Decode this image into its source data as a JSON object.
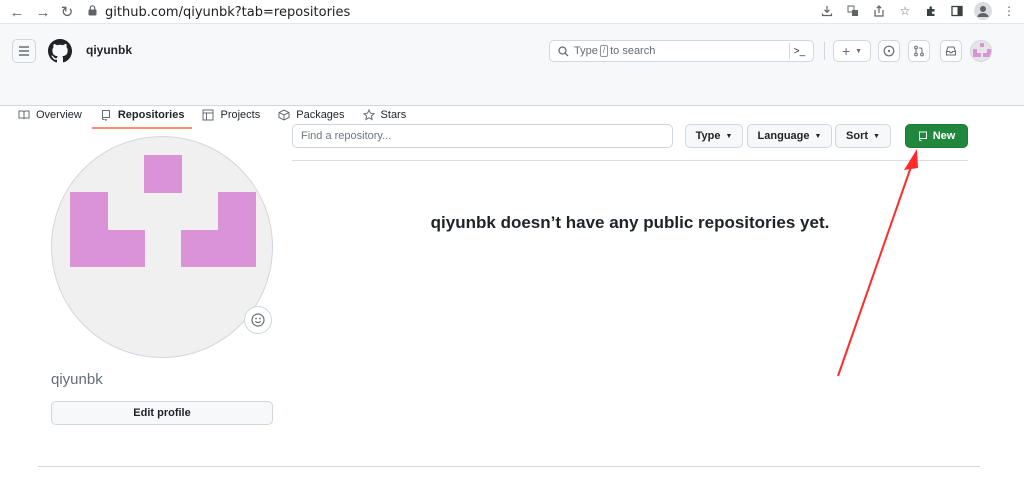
{
  "browser": {
    "url": "github.com/qiyunbk?tab=repositories",
    "icons": [
      "back-icon",
      "forward-icon",
      "reload-icon",
      "lock-icon",
      "download-icon",
      "translate-icon",
      "share-icon",
      "star-icon",
      "extensions-icon",
      "sidebar-icon",
      "profile-icon",
      "menu-icon"
    ]
  },
  "header": {
    "username": "qiyunbk",
    "search_prefix": "Type",
    "search_key": "/",
    "search_suffix": "to search",
    "command_glyph": ">_",
    "create_glyph": "+"
  },
  "tabs": [
    {
      "label": "Overview",
      "icon": "book-icon",
      "active": false
    },
    {
      "label": "Repositories",
      "icon": "repo-icon",
      "active": true
    },
    {
      "label": "Projects",
      "icon": "table-icon",
      "active": false
    },
    {
      "label": "Packages",
      "icon": "package-icon",
      "active": false
    },
    {
      "label": "Stars",
      "icon": "star-icon",
      "active": false
    }
  ],
  "profile": {
    "name": "qiyunbk",
    "edit_label": "Edit profile",
    "avatar_color": "#d993d6"
  },
  "repos": {
    "find_placeholder": "Find a repository...",
    "type_label": "Type",
    "language_label": "Language",
    "sort_label": "Sort",
    "new_label": "New",
    "empty_message": "qiyunbk doesn’t have any public repositories yet."
  },
  "colors": {
    "accent_green": "#1f883d",
    "tab_underline": "#fd8c73",
    "annotation_arrow": "#ff2a2a"
  }
}
